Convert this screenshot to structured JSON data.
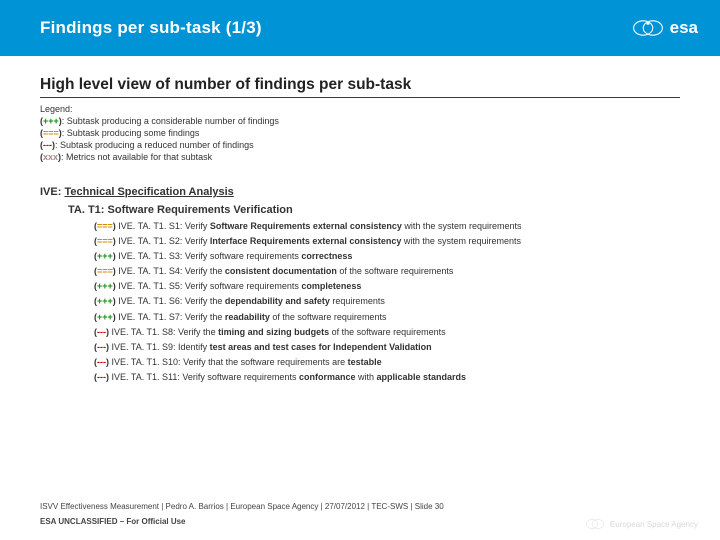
{
  "header": {
    "title": "Findings per sub-task  (1/3)",
    "logo_text": "esa"
  },
  "subtitle": "High level view of number of findings per sub-task",
  "legend": {
    "label": "Legend:",
    "items": [
      {
        "sym": "+++",
        "cls": "sym-green",
        "text": "Subtask producing a considerable number of findings"
      },
      {
        "sym": "===",
        "cls": "sym-orange",
        "text": "Subtask producing some findings"
      },
      {
        "sym": "---",
        "cls": "sym-red",
        "text": "Subtask producing a reduced number of findings"
      },
      {
        "sym": "xxx",
        "cls": "sym-grey",
        "text": "Metrics not available for that subtask"
      }
    ]
  },
  "ive": {
    "label": "IVE:",
    "title": "Technical Specification Analysis"
  },
  "ta": "TA. T1:  Software Requirements Verification",
  "rows": [
    {
      "sym": "===",
      "cls": "sym-orange",
      "code": "IVE. TA. T1. S1:",
      "pre": "Verify ",
      "bold": "Software Requirements external consistency",
      "post": " with the system requirements"
    },
    {
      "sym": "===",
      "cls": "sym-orange",
      "code": "IVE. TA. T1. S2:",
      "pre": "Verify ",
      "bold": "Interface Requirements external consistency",
      "post": " with the system requirements"
    },
    {
      "sym": "+++",
      "cls": "sym-green",
      "code": "IVE. TA. T1. S3:",
      "pre": "Verify software requirements ",
      "bold": "correctness",
      "post": ""
    },
    {
      "sym": "===",
      "cls": "sym-orange",
      "code": "IVE. TA. T1. S4:",
      "pre": "Verify the ",
      "bold": "consistent documentation",
      "post": " of the software requirements"
    },
    {
      "sym": "+++",
      "cls": "sym-green",
      "code": "IVE. TA. T1. S5:",
      "pre": "Verify software requirements ",
      "bold": "completeness",
      "post": ""
    },
    {
      "sym": "+++",
      "cls": "sym-green",
      "code": "IVE. TA. T1. S6:",
      "pre": "Verify the ",
      "bold": "dependability and safety",
      "post": " requirements"
    },
    {
      "sym": "+++",
      "cls": "sym-green",
      "code": "IVE. TA. T1. S7:",
      "pre": "Verify the ",
      "bold": "readability",
      "post": " of the software requirements"
    },
    {
      "sym": "---",
      "cls": "sym-red",
      "code": "IVE. TA. T1. S8:",
      "pre": "Verify the ",
      "bold": "timing and sizing budgets",
      "post": " of the software requirements"
    },
    {
      "sym": "---",
      "cls": "sym-red",
      "code": "IVE. TA. T1. S9:",
      "pre": "Identify ",
      "bold": "test areas and test cases for Independent Validation",
      "post": ""
    },
    {
      "sym": "---",
      "cls": "sym-red",
      "code": "IVE. TA. T1. S10:",
      "pre": "Verify that the software requirements are ",
      "bold": "testable",
      "post": ""
    },
    {
      "sym": "---",
      "cls": "sym-red",
      "code": "IVE. TA. T1. S11:",
      "pre": "Verify software requirements ",
      "bold": "conformance",
      "post": " with ",
      "bold2": "applicable standards"
    }
  ],
  "footer": {
    "line1": "ISVV Effectiveness Measurement | Pedro A. Barrios | European Space Agency | 27/07/2012 | TEC-SWS | Slide 30",
    "line2": "ESA UNCLASSIFIED – For Official Use",
    "logo_text": "European Space Agency"
  }
}
